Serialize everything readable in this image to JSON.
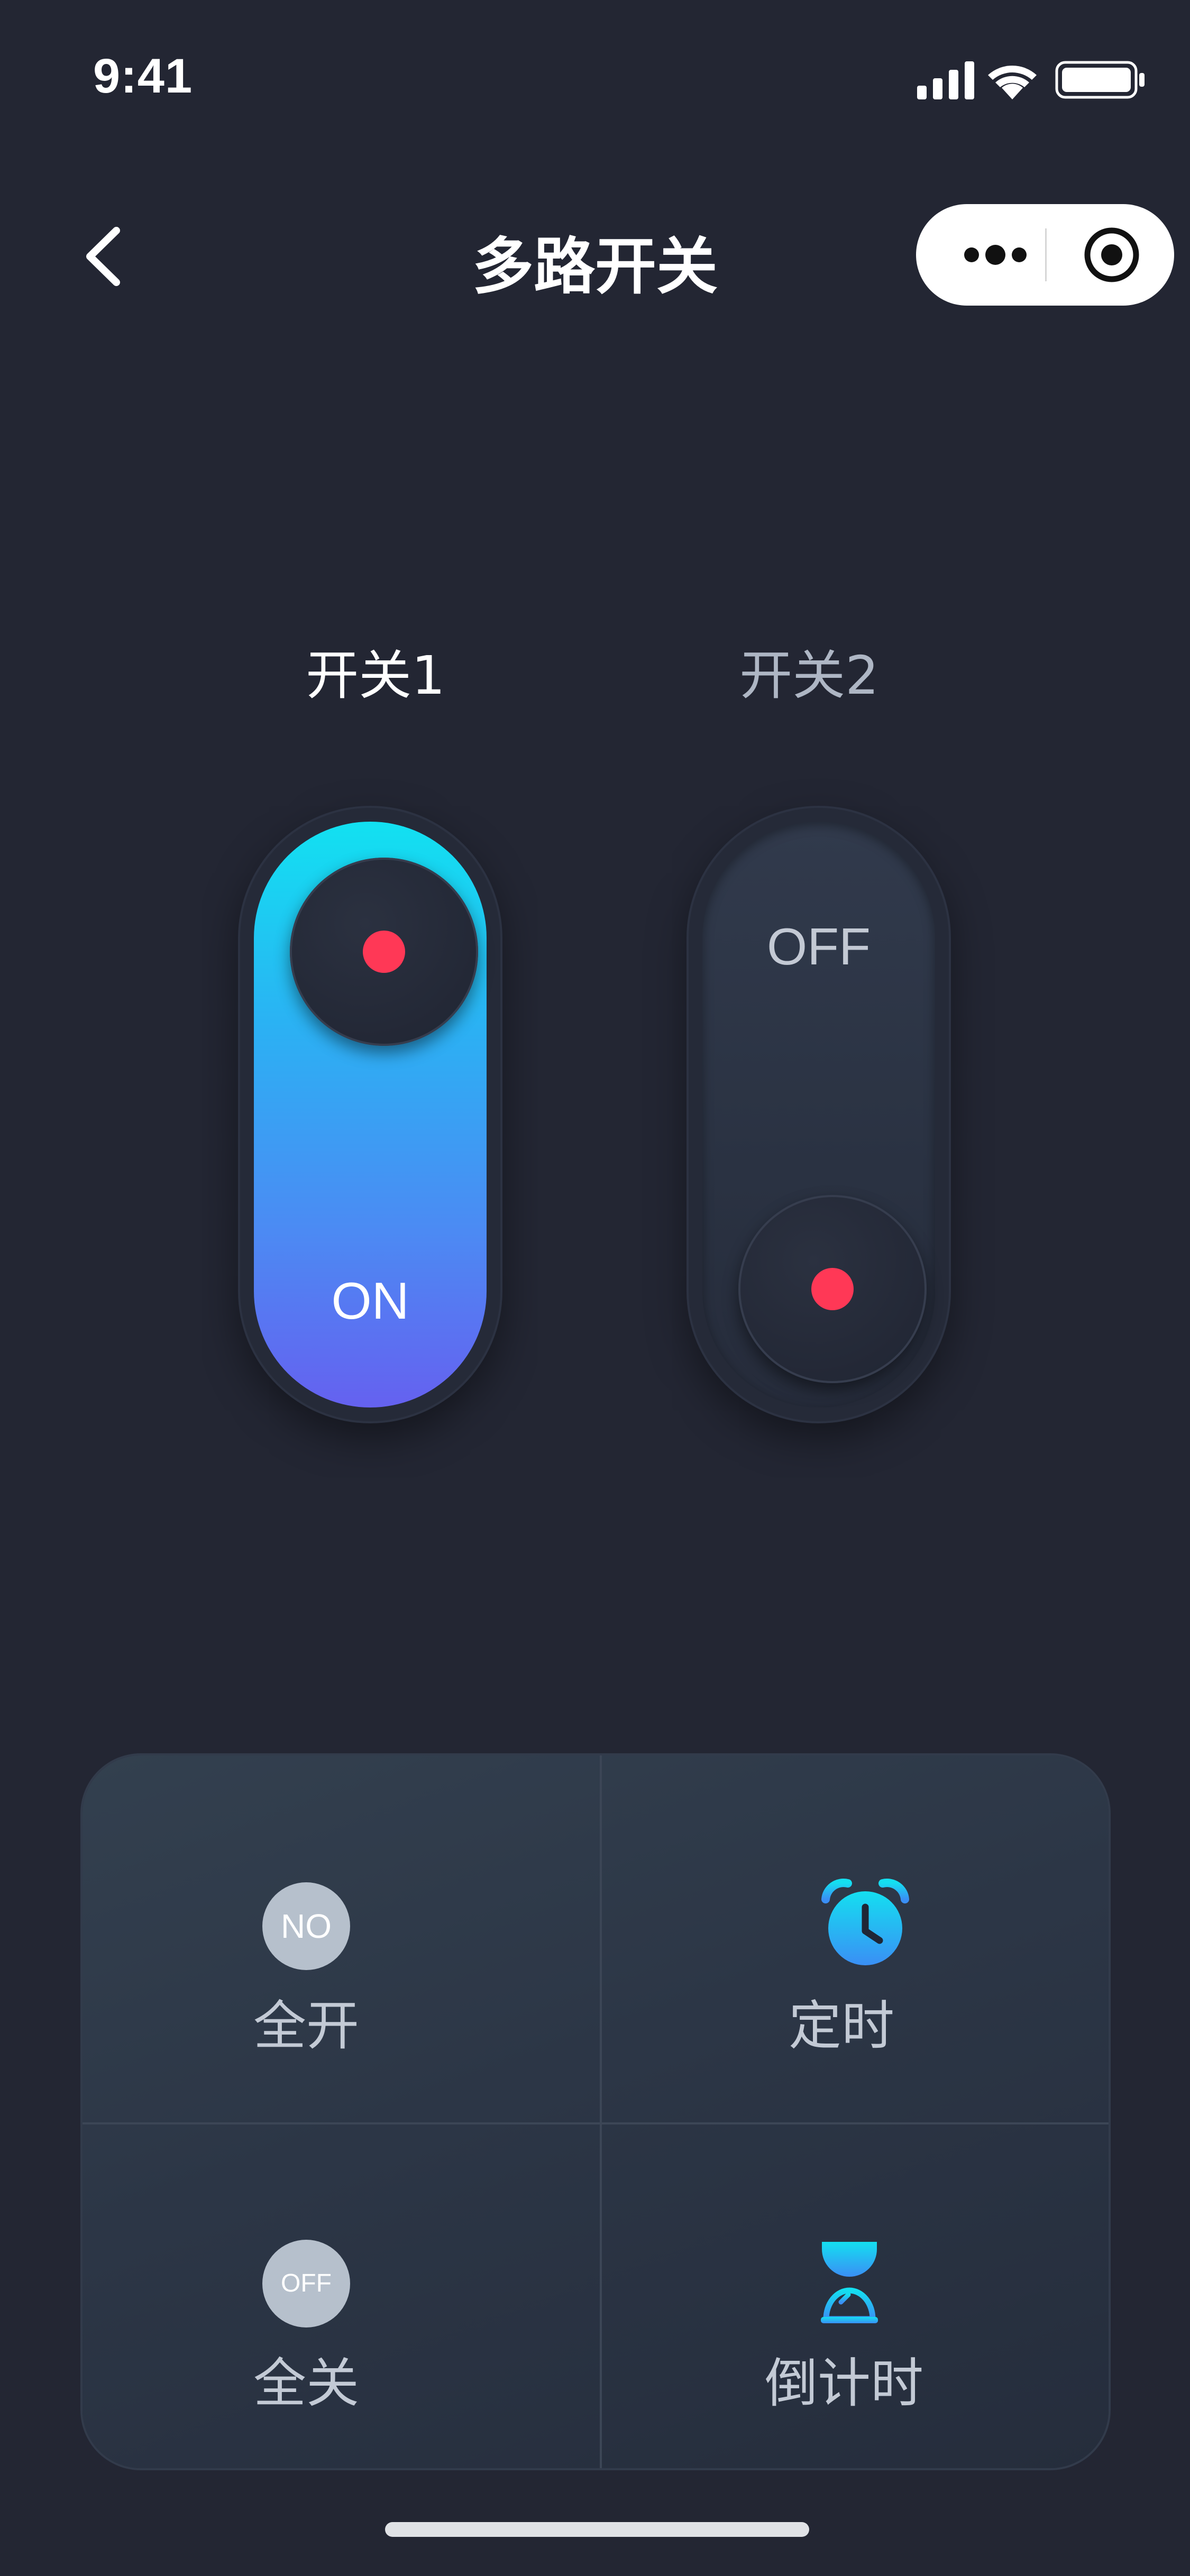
{
  "status_bar": {
    "time": "9:41",
    "icons": [
      "cellular-signal-icon",
      "wifi-icon",
      "battery-icon"
    ]
  },
  "nav": {
    "title": "多路开关",
    "back_icon": "chevron-left-icon",
    "capsule_icons": [
      "more-dots-icon",
      "target-icon"
    ]
  },
  "switches": [
    {
      "label": "开关1",
      "state": "ON"
    },
    {
      "label": "开关2",
      "state": "OFF"
    }
  ],
  "actions": [
    {
      "badge": "NO",
      "label": "全开",
      "icon": "all-on-badge"
    },
    {
      "label": "定时",
      "icon": "alarm-clock-icon"
    },
    {
      "badge": "OFF",
      "label": "全关",
      "icon": "all-off-badge"
    },
    {
      "label": "倒计时",
      "icon": "hourglass-icon"
    }
  ],
  "colors": {
    "background": "#232633",
    "switch_on_gradient": [
      "#12e1f1",
      "#6561f0"
    ],
    "indicator_dot": "#ff3856",
    "label_active": "#ffffff",
    "label_inactive": "#aeb6c4"
  }
}
